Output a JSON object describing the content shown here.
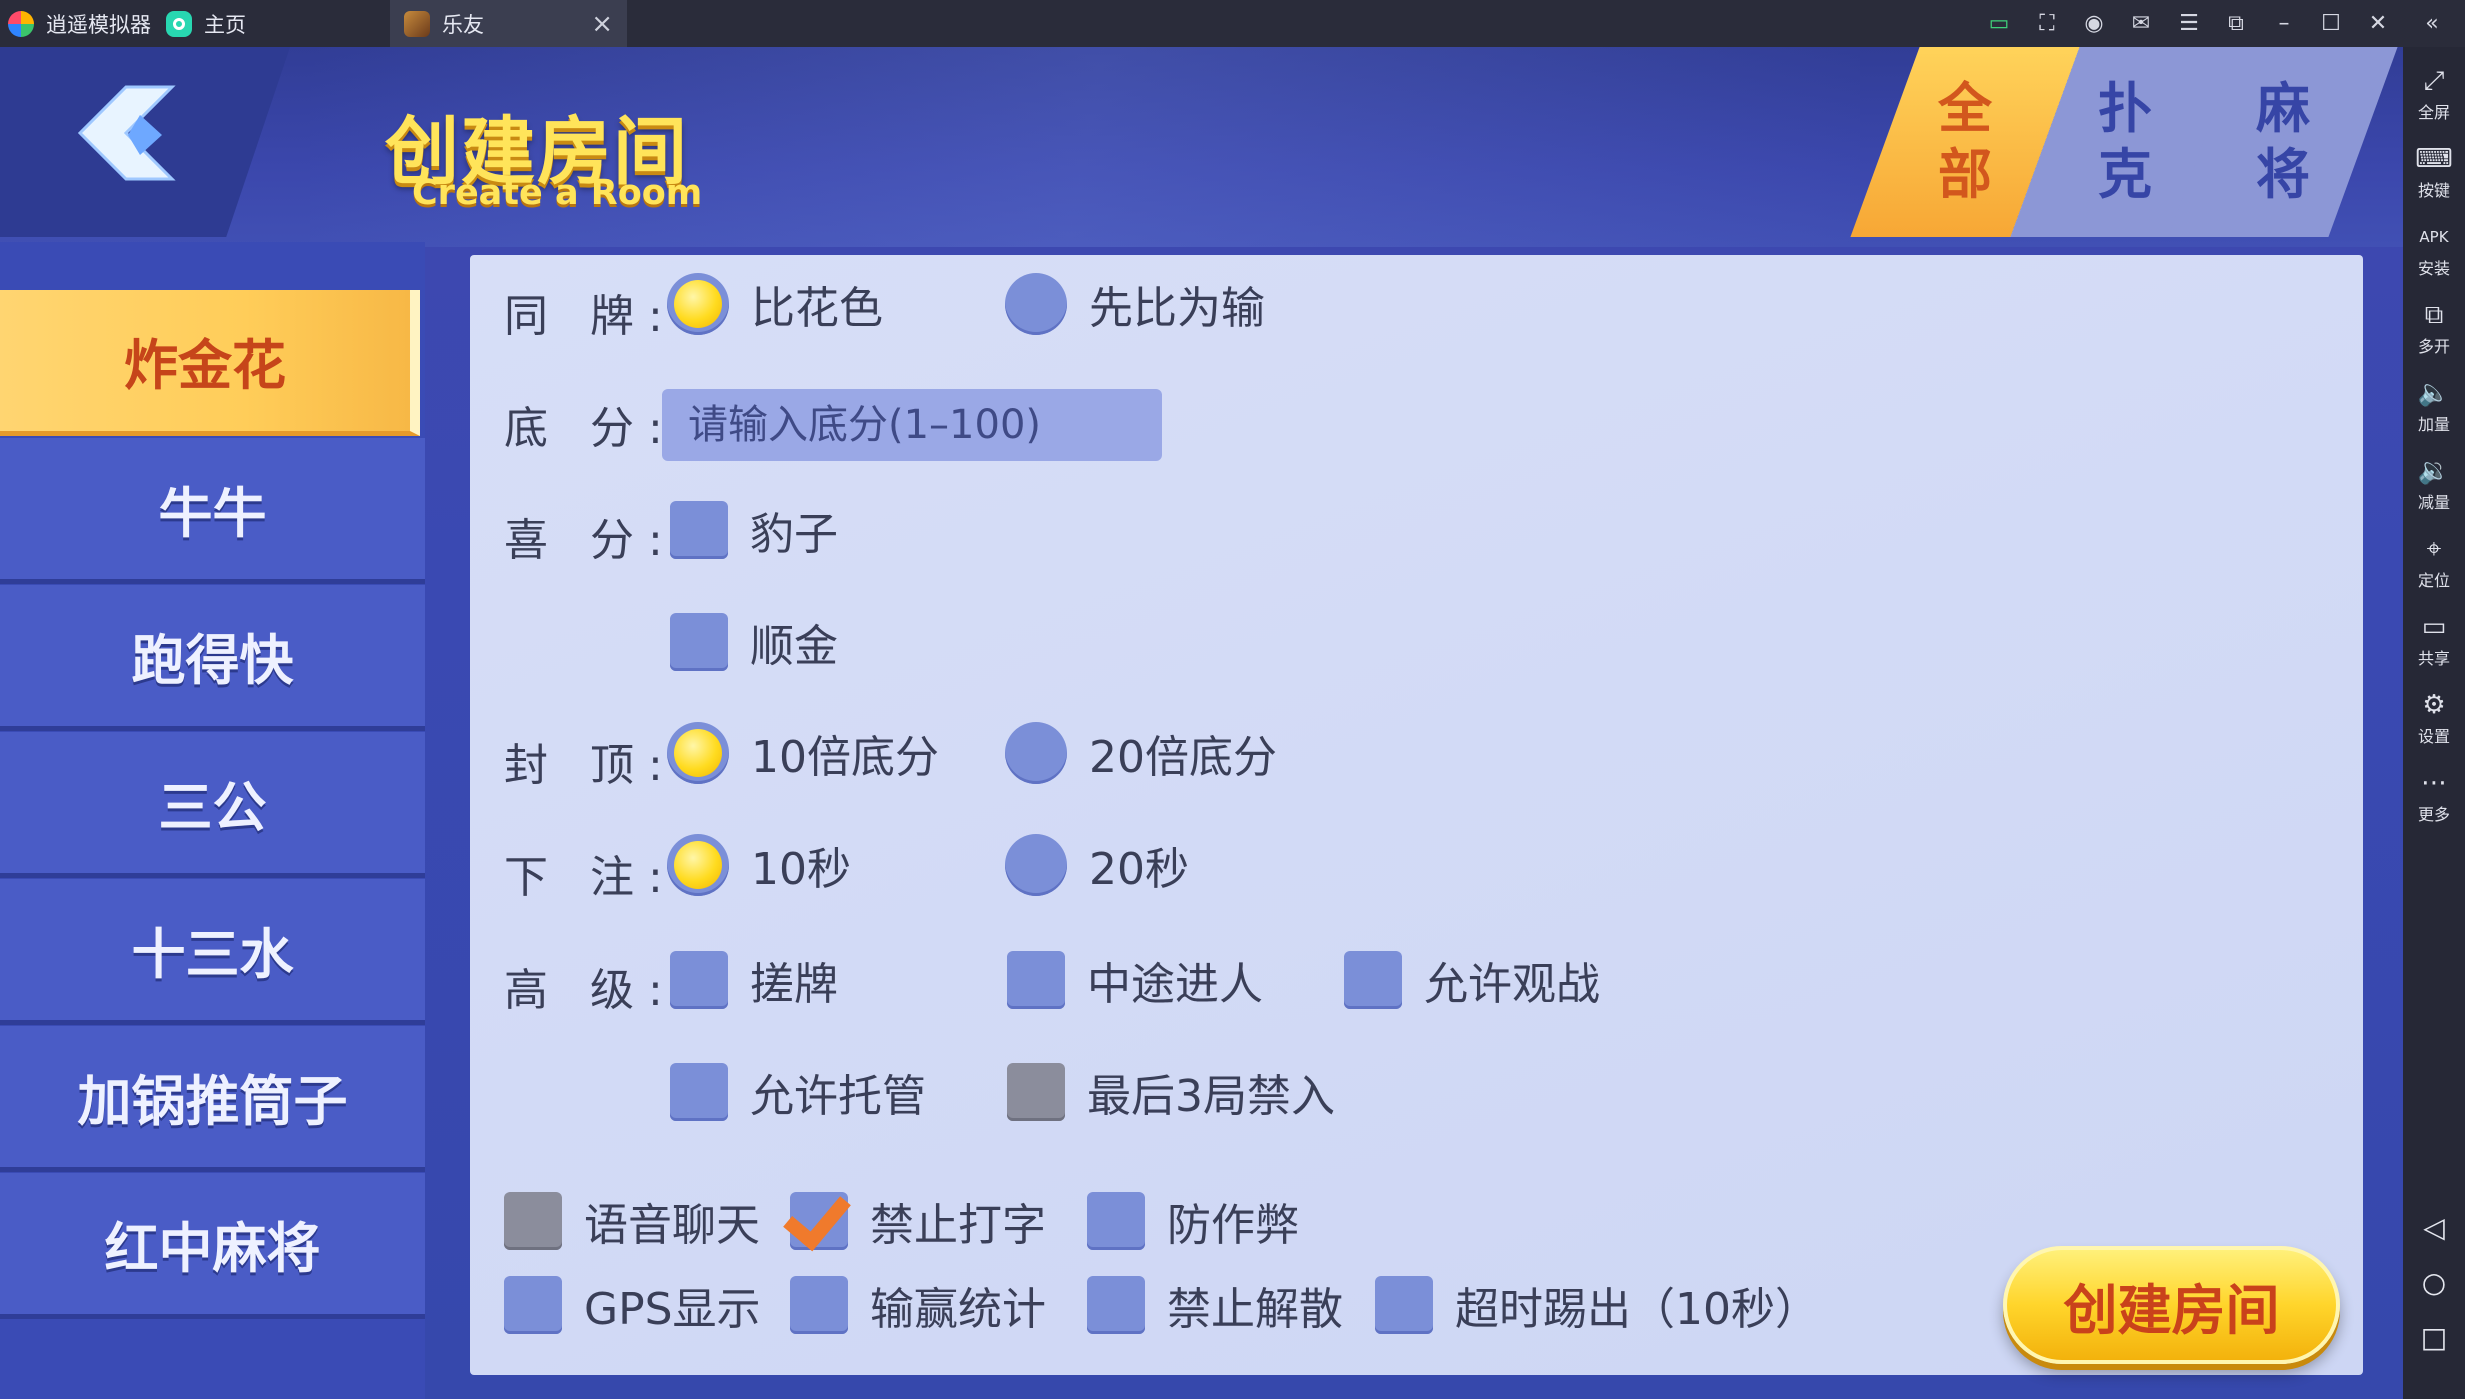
{
  "window": {
    "tabs": [
      {
        "label": "逍遥模拟器"
      },
      {
        "label": "主页"
      },
      {
        "label": "乐友"
      }
    ]
  },
  "sidebar": {
    "items": [
      {
        "icon": "fullscreen-icon",
        "label": "全屏"
      },
      {
        "icon": "keyboard-icon",
        "label": "按键"
      },
      {
        "icon": "apk-install-icon",
        "label": "安装"
      },
      {
        "icon": "multi-instance-icon",
        "label": "多开"
      },
      {
        "icon": "volume-up-icon",
        "label": "加量"
      },
      {
        "icon": "volume-down-icon",
        "label": "减量"
      },
      {
        "icon": "location-icon",
        "label": "定位"
      },
      {
        "icon": "folder-icon",
        "label": "共享"
      },
      {
        "icon": "gear-icon",
        "label": "设置"
      },
      {
        "icon": "more-icon",
        "label": "更多"
      }
    ]
  },
  "header": {
    "title": "创建房间",
    "subtitle": "Create a Room",
    "categories": [
      {
        "label": "全部",
        "line1": "全",
        "line2": "部",
        "active": true
      },
      {
        "label": "扑克",
        "line1": "扑",
        "line2": "克",
        "active": false
      },
      {
        "label": "麻将",
        "line1": "麻",
        "line2": "将",
        "active": false
      }
    ]
  },
  "games": [
    {
      "label": "炸金花",
      "active": true
    },
    {
      "label": "牛牛"
    },
    {
      "label": "跑得快"
    },
    {
      "label": "三公"
    },
    {
      "label": "十三水"
    },
    {
      "label": "加锅推筒子"
    },
    {
      "label": "红中麻将"
    }
  ],
  "settings": {
    "same_card": {
      "label": "同 牌:",
      "options": [
        {
          "label": "比花色",
          "selected": true
        },
        {
          "label": "先比为输",
          "selected": false
        }
      ]
    },
    "base_score": {
      "label": "底 分:",
      "placeholder": "请输入底分(1–100)",
      "value": ""
    },
    "bonus": {
      "label": "喜 分:",
      "options": [
        {
          "label": "豹子",
          "checked": false
        },
        {
          "label": "顺金",
          "checked": false
        }
      ]
    },
    "cap": {
      "label": "封 顶:",
      "options": [
        {
          "label": "10倍底分",
          "selected": true
        },
        {
          "label": "20倍底分",
          "selected": false
        }
      ]
    },
    "bet": {
      "label": "下 注:",
      "options": [
        {
          "label": "10秒",
          "selected": true
        },
        {
          "label": "20秒",
          "selected": false
        }
      ]
    },
    "advanced": {
      "label": "高 级:",
      "options": [
        {
          "label": "搓牌",
          "checked": false
        },
        {
          "label": "中途进人",
          "checked": false
        },
        {
          "label": "允许观战",
          "checked": false
        },
        {
          "label": "允许托管",
          "checked": false
        },
        {
          "label": "最后3局禁入",
          "checked": false,
          "disabled": true
        }
      ]
    },
    "extras": [
      {
        "label": "语音聊天",
        "checked": false,
        "disabled": true
      },
      {
        "label": "禁止打字",
        "checked": true
      },
      {
        "label": "防作弊",
        "checked": false
      },
      {
        "label": "GPS显示",
        "checked": false
      },
      {
        "label": "输赢统计",
        "checked": false
      },
      {
        "label": "禁止解散",
        "checked": false
      },
      {
        "label": "超时踢出（10秒）",
        "checked": false
      }
    ]
  },
  "actions": {
    "create_label": "创建房间"
  }
}
